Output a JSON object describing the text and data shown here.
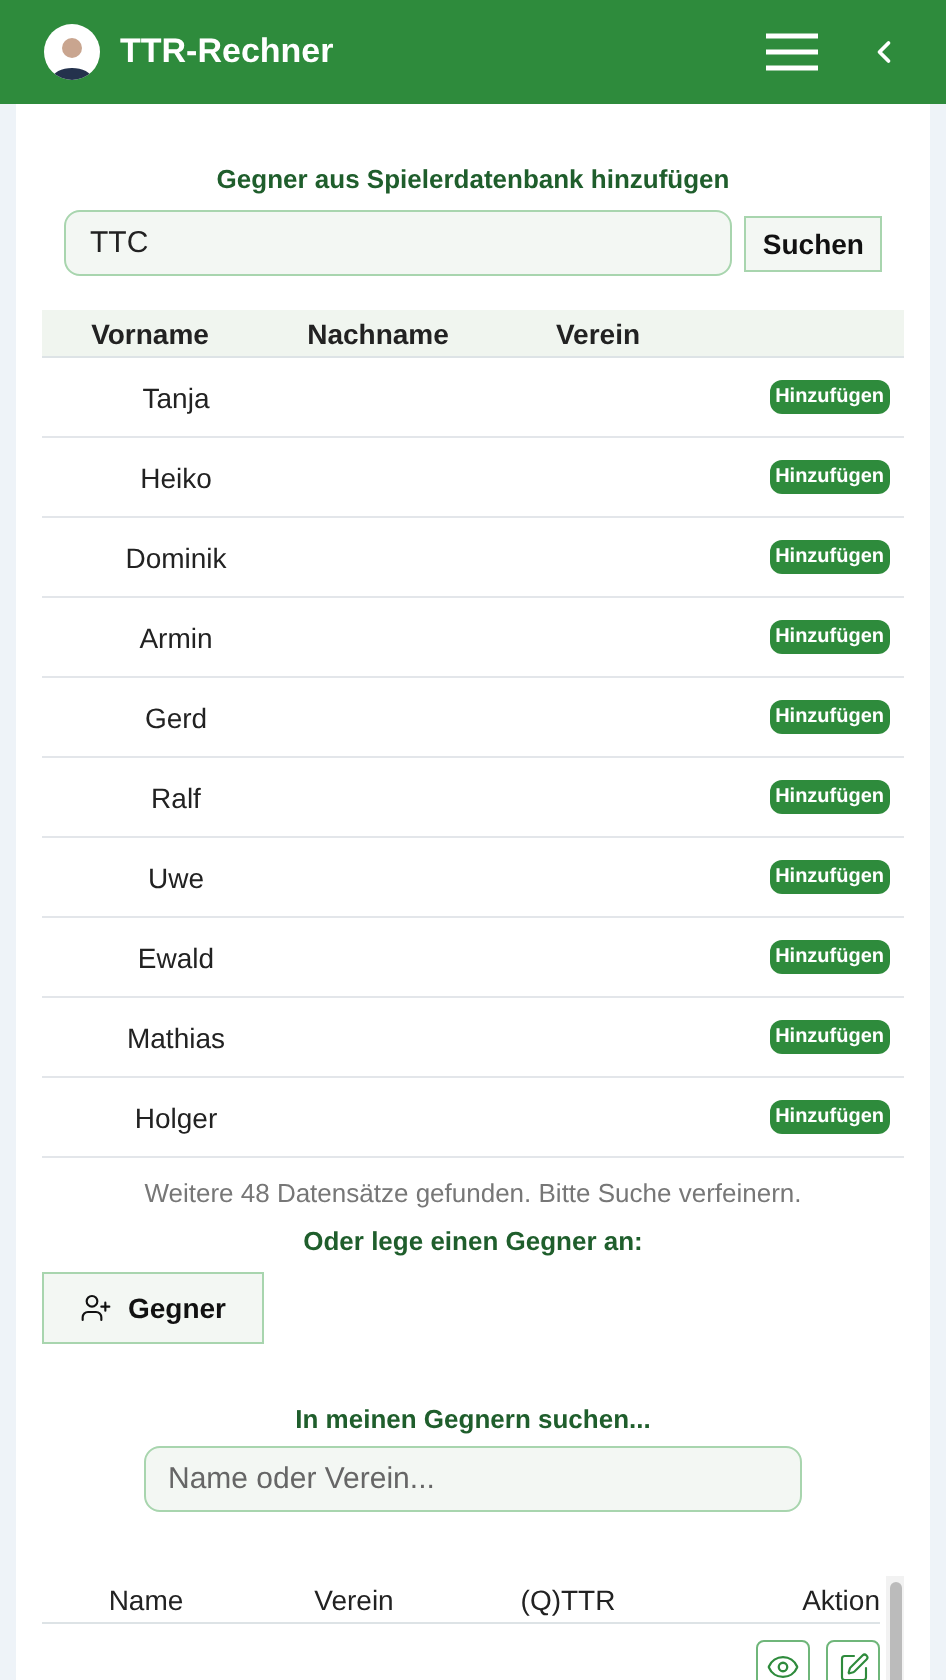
{
  "app_bar": {
    "title": "TTR-Rechner"
  },
  "db_search": {
    "heading": "Gegner aus Spielerdatenbank hinzufügen",
    "value": "TTC",
    "button": "Suchen"
  },
  "results": {
    "columns": [
      "Vorname",
      "Nachname",
      "Verein"
    ],
    "rows": [
      {
        "first_name": "Tanja",
        "action": "Hinzufügen"
      },
      {
        "first_name": "Heiko",
        "action": "Hinzufügen"
      },
      {
        "first_name": "Dominik",
        "action": "Hinzufügen"
      },
      {
        "first_name": "Armin",
        "action": "Hinzufügen"
      },
      {
        "first_name": "Gerd",
        "action": "Hinzufügen"
      },
      {
        "first_name": "Ralf",
        "action": "Hinzufügen"
      },
      {
        "first_name": "Uwe",
        "action": "Hinzufügen"
      },
      {
        "first_name": "Ewald",
        "action": "Hinzufügen"
      },
      {
        "first_name": "Mathias",
        "action": "Hinzufügen"
      },
      {
        "first_name": "Holger",
        "action": "Hinzufügen"
      }
    ],
    "note": "Weitere 48 Datensätze gefunden. Bitte Suche verfeinern."
  },
  "create": {
    "heading": "Oder lege einen Gegner an:",
    "button": "Gegner"
  },
  "my_opponents": {
    "heading": "In meinen Gegnern suchen...",
    "placeholder": "Name oder Verein...",
    "columns": [
      "Name",
      "Verein",
      "(Q)TTR",
      "Aktion"
    ]
  }
}
